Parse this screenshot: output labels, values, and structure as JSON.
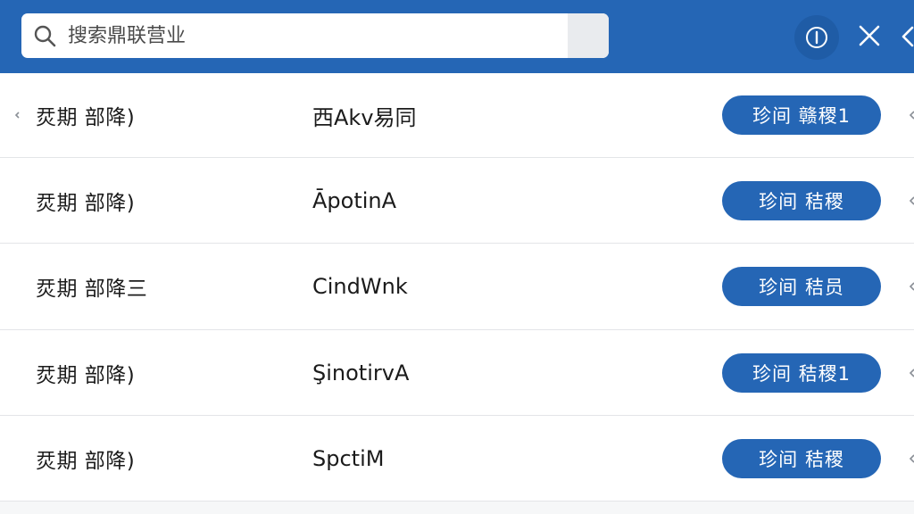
{
  "search": {
    "placeholder": "搜索鼎联营业",
    "value": ""
  },
  "header": {
    "info_icon": "info-circle-icon",
    "close_icon": "close-icon",
    "back_icon": "chevron-left-icon"
  },
  "colors": {
    "header_bg": "#2566b5",
    "button_bg": "#2566b5",
    "button_text": "#ffffff",
    "row_bg": "#ffffff",
    "divider": "#e3e5e8"
  },
  "rows": [
    {
      "name": "烎期 部降)",
      "code": "西Akv易同",
      "action": "珍间 赣稷1"
    },
    {
      "name": "烎期 部降)",
      "code": "ĀpotinA",
      "action": "珍间 秸稷"
    },
    {
      "name": "烎期 部降三",
      "code": "CindWnk",
      "action": "珍间 秸员"
    },
    {
      "name": "烎期 部降)",
      "code": "ŞinotirvA",
      "action": "珍间 秸稷1"
    },
    {
      "name": "烎期 部降)",
      "code": "SpctiM",
      "action": "珍间 秸稷"
    }
  ]
}
